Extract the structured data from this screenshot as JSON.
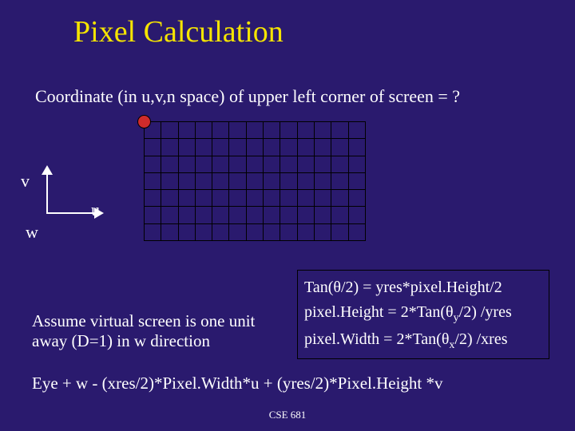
{
  "title": "Pixel Calculation",
  "subtitle": "Coordinate (in u,v,n space) of upper left corner of screen = ?",
  "axes": {
    "v": "v",
    "u": "u",
    "w": "w"
  },
  "assume": "Assume virtual screen is one unit away (D=1) in w direction",
  "formulas": {
    "f1_a": "Tan(θ/2) = yres*pixel.Height/2",
    "f2_a": "pixel.Height = 2*Tan(θ",
    "f2_sub": "y",
    "f2_b": "/2) /yres",
    "f3_a": "pixel.Width = 2*Tan(θ",
    "f3_sub": "x",
    "f3_b": "/2) /xres"
  },
  "eye_formula": "Eye + w - (xres/2)*Pixel.Width*u + (yres/2)*Pixel.Height *v",
  "footer": "CSE 681",
  "grid": {
    "rows": 7,
    "cols": 13
  }
}
